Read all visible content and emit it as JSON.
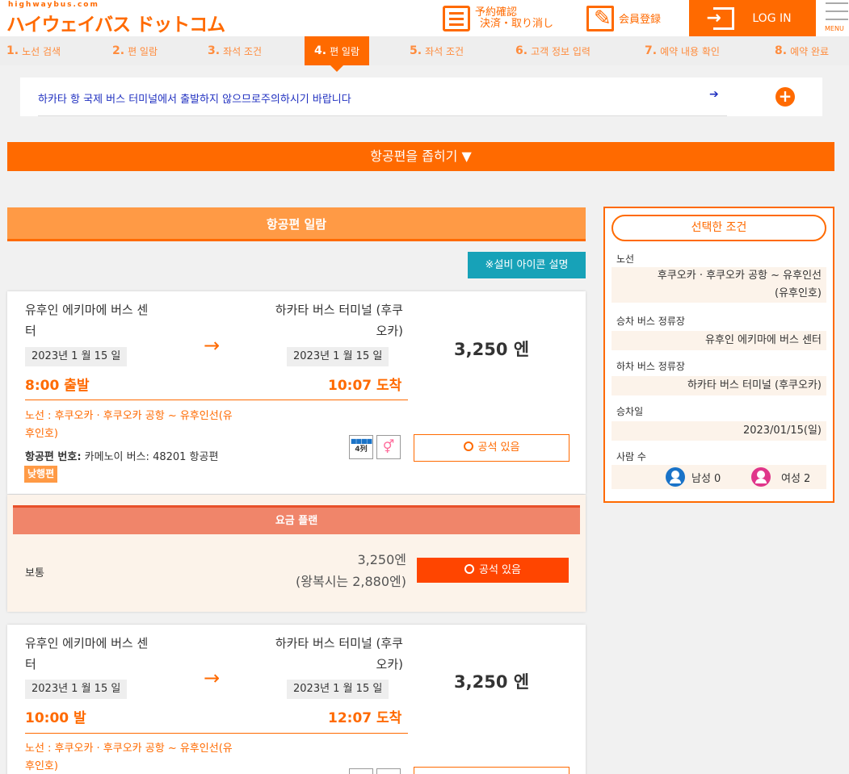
{
  "header": {
    "logo_small": "highwaybus.com",
    "logo": "ハイウェイバス ドットコム",
    "reservation_line1": "予約確認",
    "reservation_line2": "決済・取り消し",
    "member_register": "会員登録",
    "login": "LOG IN",
    "menu": "MENU"
  },
  "steps": [
    {
      "num": "1.",
      "label": "노선 검색"
    },
    {
      "num": "2.",
      "label": "편 일람"
    },
    {
      "num": "3.",
      "label": "좌석 조건"
    },
    {
      "num": "4.",
      "label": "편 일람"
    },
    {
      "num": "5.",
      "label": "좌석 조건"
    },
    {
      "num": "6.",
      "label": "고객 정보 입력"
    },
    {
      "num": "7.",
      "label": "예약 내용 확인"
    },
    {
      "num": "8.",
      "label": "예약 완료"
    }
  ],
  "notice": {
    "text": "하카타 항 국제 버스 터미널에서 출발하지 않으므로주의하시기 바랍니다",
    "arrow": "➔",
    "plus": "+"
  },
  "collapse_label": "항공편을 좁히기 ▼",
  "list_title": "항공편 일람",
  "facility_button": "※설비 아이콘 설명",
  "flights": [
    {
      "from_line1": "유후인 에키마에 버스 센",
      "from_line2": "터",
      "to_line1": "하카타 버스 터미널 (후쿠",
      "to_line2": "오카)",
      "dep_date": "2023년 1 월 15 일",
      "arr_date": "2023년 1 월 15 일",
      "dep_time": "8:00 출발",
      "arr_time": "10:07 도착",
      "price": "3,250 엔",
      "route_line1": "노선 :  후쿠오카 · 후쿠오카 공항 ~ 유후인선(유",
      "route_line2": "후인호)",
      "flight_label": "항공편 번호:",
      "flight_value": " 카메노이 버스: 48201 항공편",
      "badge": "낮행편",
      "seat_icon": "4列",
      "availability": "공석 있음"
    },
    {
      "from_line1": "유후인 에키마에 버스 센",
      "from_line2": "터",
      "to_line1": "하카타 버스 터미널 (후쿠",
      "to_line2": "오카)",
      "dep_date": "2023년 1 월 15 일",
      "arr_date": "2023년 1 월 15 일",
      "dep_time": "10:00 발",
      "arr_time": "12:07 도착",
      "price": "3,250 엔",
      "route_line1": "노선 :  후쿠오카 · 후쿠오카 공항 ~ 유후인선(유",
      "route_line2": "후인호)"
    }
  ],
  "fare_plan": {
    "title": "요금 플랜",
    "name": "보통",
    "price": "3,250엔",
    "round_trip": "(왕복시는 2,880엔)",
    "availability": "공석 있음"
  },
  "side": {
    "title": "선택한 조건",
    "route_label": "노선",
    "route_value_line1": "후쿠오카 · 후쿠오카 공항 ~ 유후인선",
    "route_value_line2": "(유후인호)",
    "board_label": "승차 버스 정류장",
    "board_value": "유후인 에키마에 버스 센터",
    "alight_label": "하차 버스 정류장",
    "alight_value": "하카타 버스 터미널 (후쿠오카)",
    "date_label": "승차일",
    "date_value": "2023/01/15(일)",
    "people_label": "사람 수",
    "male": "남성  0",
    "female": "여성  2"
  },
  "colors": {
    "accent": "#ff6a00",
    "male_icon": "#1a73c8",
    "female_icon": "#e0368a"
  }
}
